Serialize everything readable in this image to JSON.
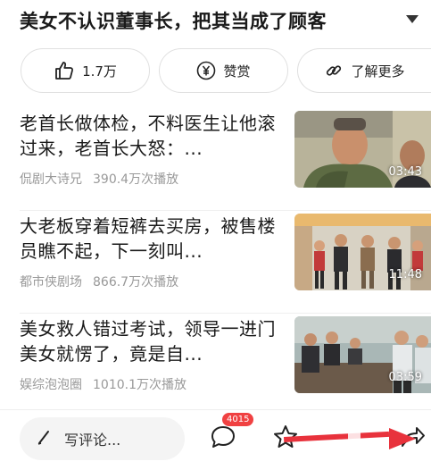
{
  "header": {
    "title": "美女不认识董事长，把其当成了顾客",
    "expand_icon": "chevron-down-icon"
  },
  "actions": {
    "like_label": "1.7万",
    "reward_label": "赞赏",
    "learn_more_label": "了解更多"
  },
  "videos": [
    {
      "title": "老首长做体检，不料医生让他滚过来，老首长大怒：...",
      "author": "侃剧大诗兄",
      "plays": "390.4万次播放",
      "duration": "03:43"
    },
    {
      "title": "大老板穿着短裤去买房，被售楼员瞧不起，下一刻叫...",
      "author": "都市侠剧场",
      "plays": "866.7万次播放",
      "duration": "11:48"
    },
    {
      "title": "美女救人错过考试，领导一进门美女就愣了，竟是自...",
      "author": "娱综泡泡圈",
      "plays": "1010.1万次播放",
      "duration": "03:59"
    }
  ],
  "bottom_bar": {
    "comment_placeholder": "写评论...",
    "comment_count": "4015"
  },
  "colors": {
    "badge": "#f04142",
    "annotation_arrow": "#e8323c"
  }
}
